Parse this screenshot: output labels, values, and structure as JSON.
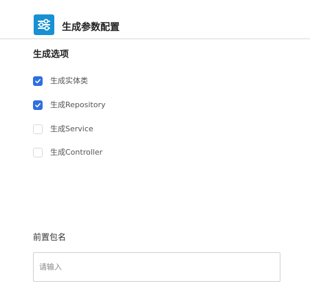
{
  "header": {
    "title": "生成参数配置",
    "icon": "sliders-icon",
    "icon_color": "#1890d4"
  },
  "options_section": {
    "title": "生成选项",
    "items": [
      {
        "label": "生成实体类",
        "checked": true
      },
      {
        "label": "生成Repository",
        "checked": true
      },
      {
        "label": "生成Service",
        "checked": false
      },
      {
        "label": "生成Controller",
        "checked": false
      }
    ],
    "checked_color": "#2f6fe0"
  },
  "package_field": {
    "label": "前置包名",
    "value": "",
    "placeholder": "请输入"
  }
}
